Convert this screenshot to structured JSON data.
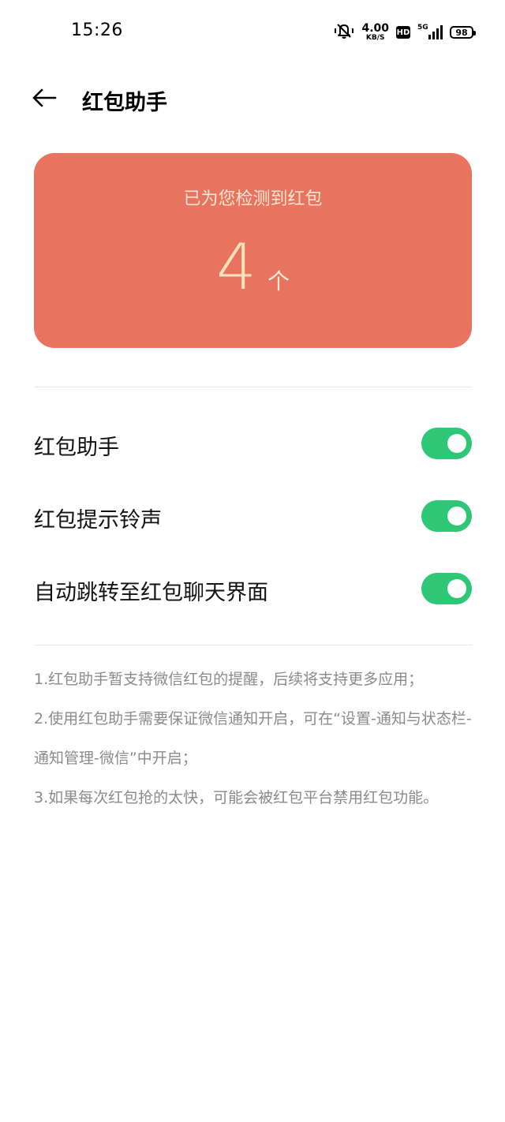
{
  "status_bar": {
    "time": "15:26",
    "net_speed_value": "4.00",
    "net_speed_unit": "KB/S",
    "hd_label": "HD",
    "network_type": "5G",
    "battery_level": "98"
  },
  "header": {
    "title": "红包助手"
  },
  "count_card": {
    "label": "已为您检测到红包",
    "count": "4",
    "unit": "个",
    "background_color": "#e8735f"
  },
  "settings": [
    {
      "label": "红包助手",
      "enabled": true
    },
    {
      "label": "红包提示铃声",
      "enabled": true
    },
    {
      "label": "自动跳转至红包聊天界面",
      "enabled": true
    }
  ],
  "toggle_color": "#2dc775",
  "notes": [
    "1.红包助手暂支持微信红包的提醒，后续将支持更多应用；",
    "2.使用红包助手需要保证微信通知开启，可在“设置-通知与状态栏-通知管理-微信”中开启；",
    "3.如果每次红包抢的太快，可能会被红包平台禁用红包功能。"
  ]
}
